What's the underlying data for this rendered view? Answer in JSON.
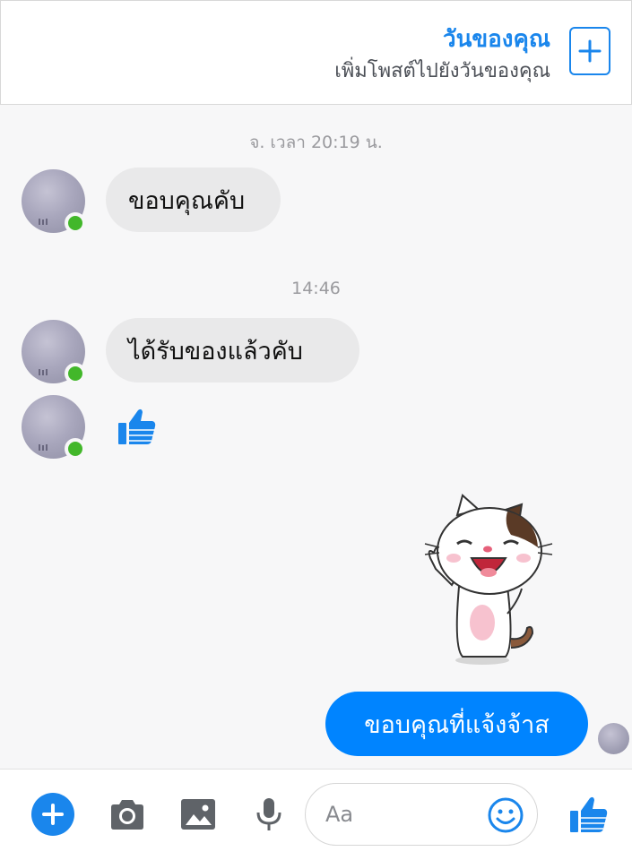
{
  "story": {
    "title": "วันของคุณ",
    "subtitle": "เพิ่มโพสต์ไปยังวันของคุณ",
    "add_icon": "plus-square-icon"
  },
  "conversation": {
    "timestamps": [
      "จ. เวลา 20:19 น.",
      "14:46"
    ],
    "incoming": [
      {
        "text": "ขอบคุณคับ"
      },
      {
        "text": "ได้รับของแล้วคับ"
      },
      {
        "type": "like",
        "icon": "thumbs-up-icon"
      }
    ],
    "sticker": {
      "icon": "waving-cat-sticker"
    },
    "outgoing": [
      {
        "text": "ขอบคุณที่แจ้งจ้าส"
      }
    ]
  },
  "composer": {
    "placeholder": "Aa",
    "icons": [
      "plus-circle-icon",
      "camera-icon",
      "image-icon",
      "microphone-icon",
      "emoji-icon",
      "thumbs-up-icon"
    ]
  },
  "colors": {
    "accent": "#1a86ec",
    "outgoing_bubble": "#0084ff",
    "incoming_bubble": "#e9e9ea",
    "online": "#42b72a"
  }
}
